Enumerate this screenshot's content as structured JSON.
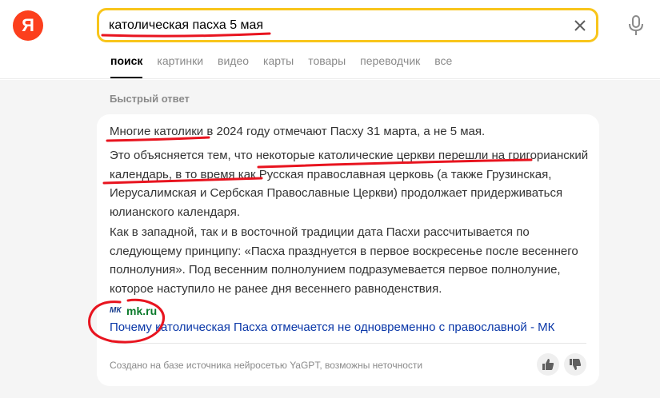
{
  "logo": {
    "letter": "Я"
  },
  "search": {
    "query": "католическая пасха 5 мая"
  },
  "tabs": [
    "поиск",
    "картинки",
    "видео",
    "карты",
    "товары",
    "переводчик",
    "все"
  ],
  "quick_answer": {
    "label": "Быстрый ответ",
    "p1": "Многие католики в 2024 году отмечают Пасху 31 марта, а не 5 мая.",
    "p2": "Это объясняется тем, что некоторые католические церкви перешли на григорианский календарь, в то время как Русская православная церковь (а также Грузинская, Иерусалимская и Сербская Православные Церкви) продолжает придерживаться юлианского календаря.",
    "p3": "Как в западной, так и в восточной традиции дата Пасхи рассчитывается по следующему принципу: «Пасха празднуется в первое воскресенье после весеннего полнолуния». Под весенним полнолунием подразумевается первое полнолуние, которое наступило не ранее дня весеннего равноденствия.",
    "source": {
      "favicon": "МК",
      "domain": "mk.ru",
      "link": "Почему католическая Пасха отмечается не одновременно с православной - МК"
    },
    "note": "Создано на базе источника нейросетью YaGPT, возможны неточности"
  },
  "colors": {
    "accent_yellow": "#f8c51b",
    "logo_red": "#fc3f1d",
    "annotation_red": "#e8141f",
    "link_blue": "#0b38a8",
    "domain_green": "#0b7a2b"
  },
  "icons": [
    "clear-icon",
    "microphone-icon",
    "thumbs-up-icon",
    "thumbs-down-icon"
  ]
}
